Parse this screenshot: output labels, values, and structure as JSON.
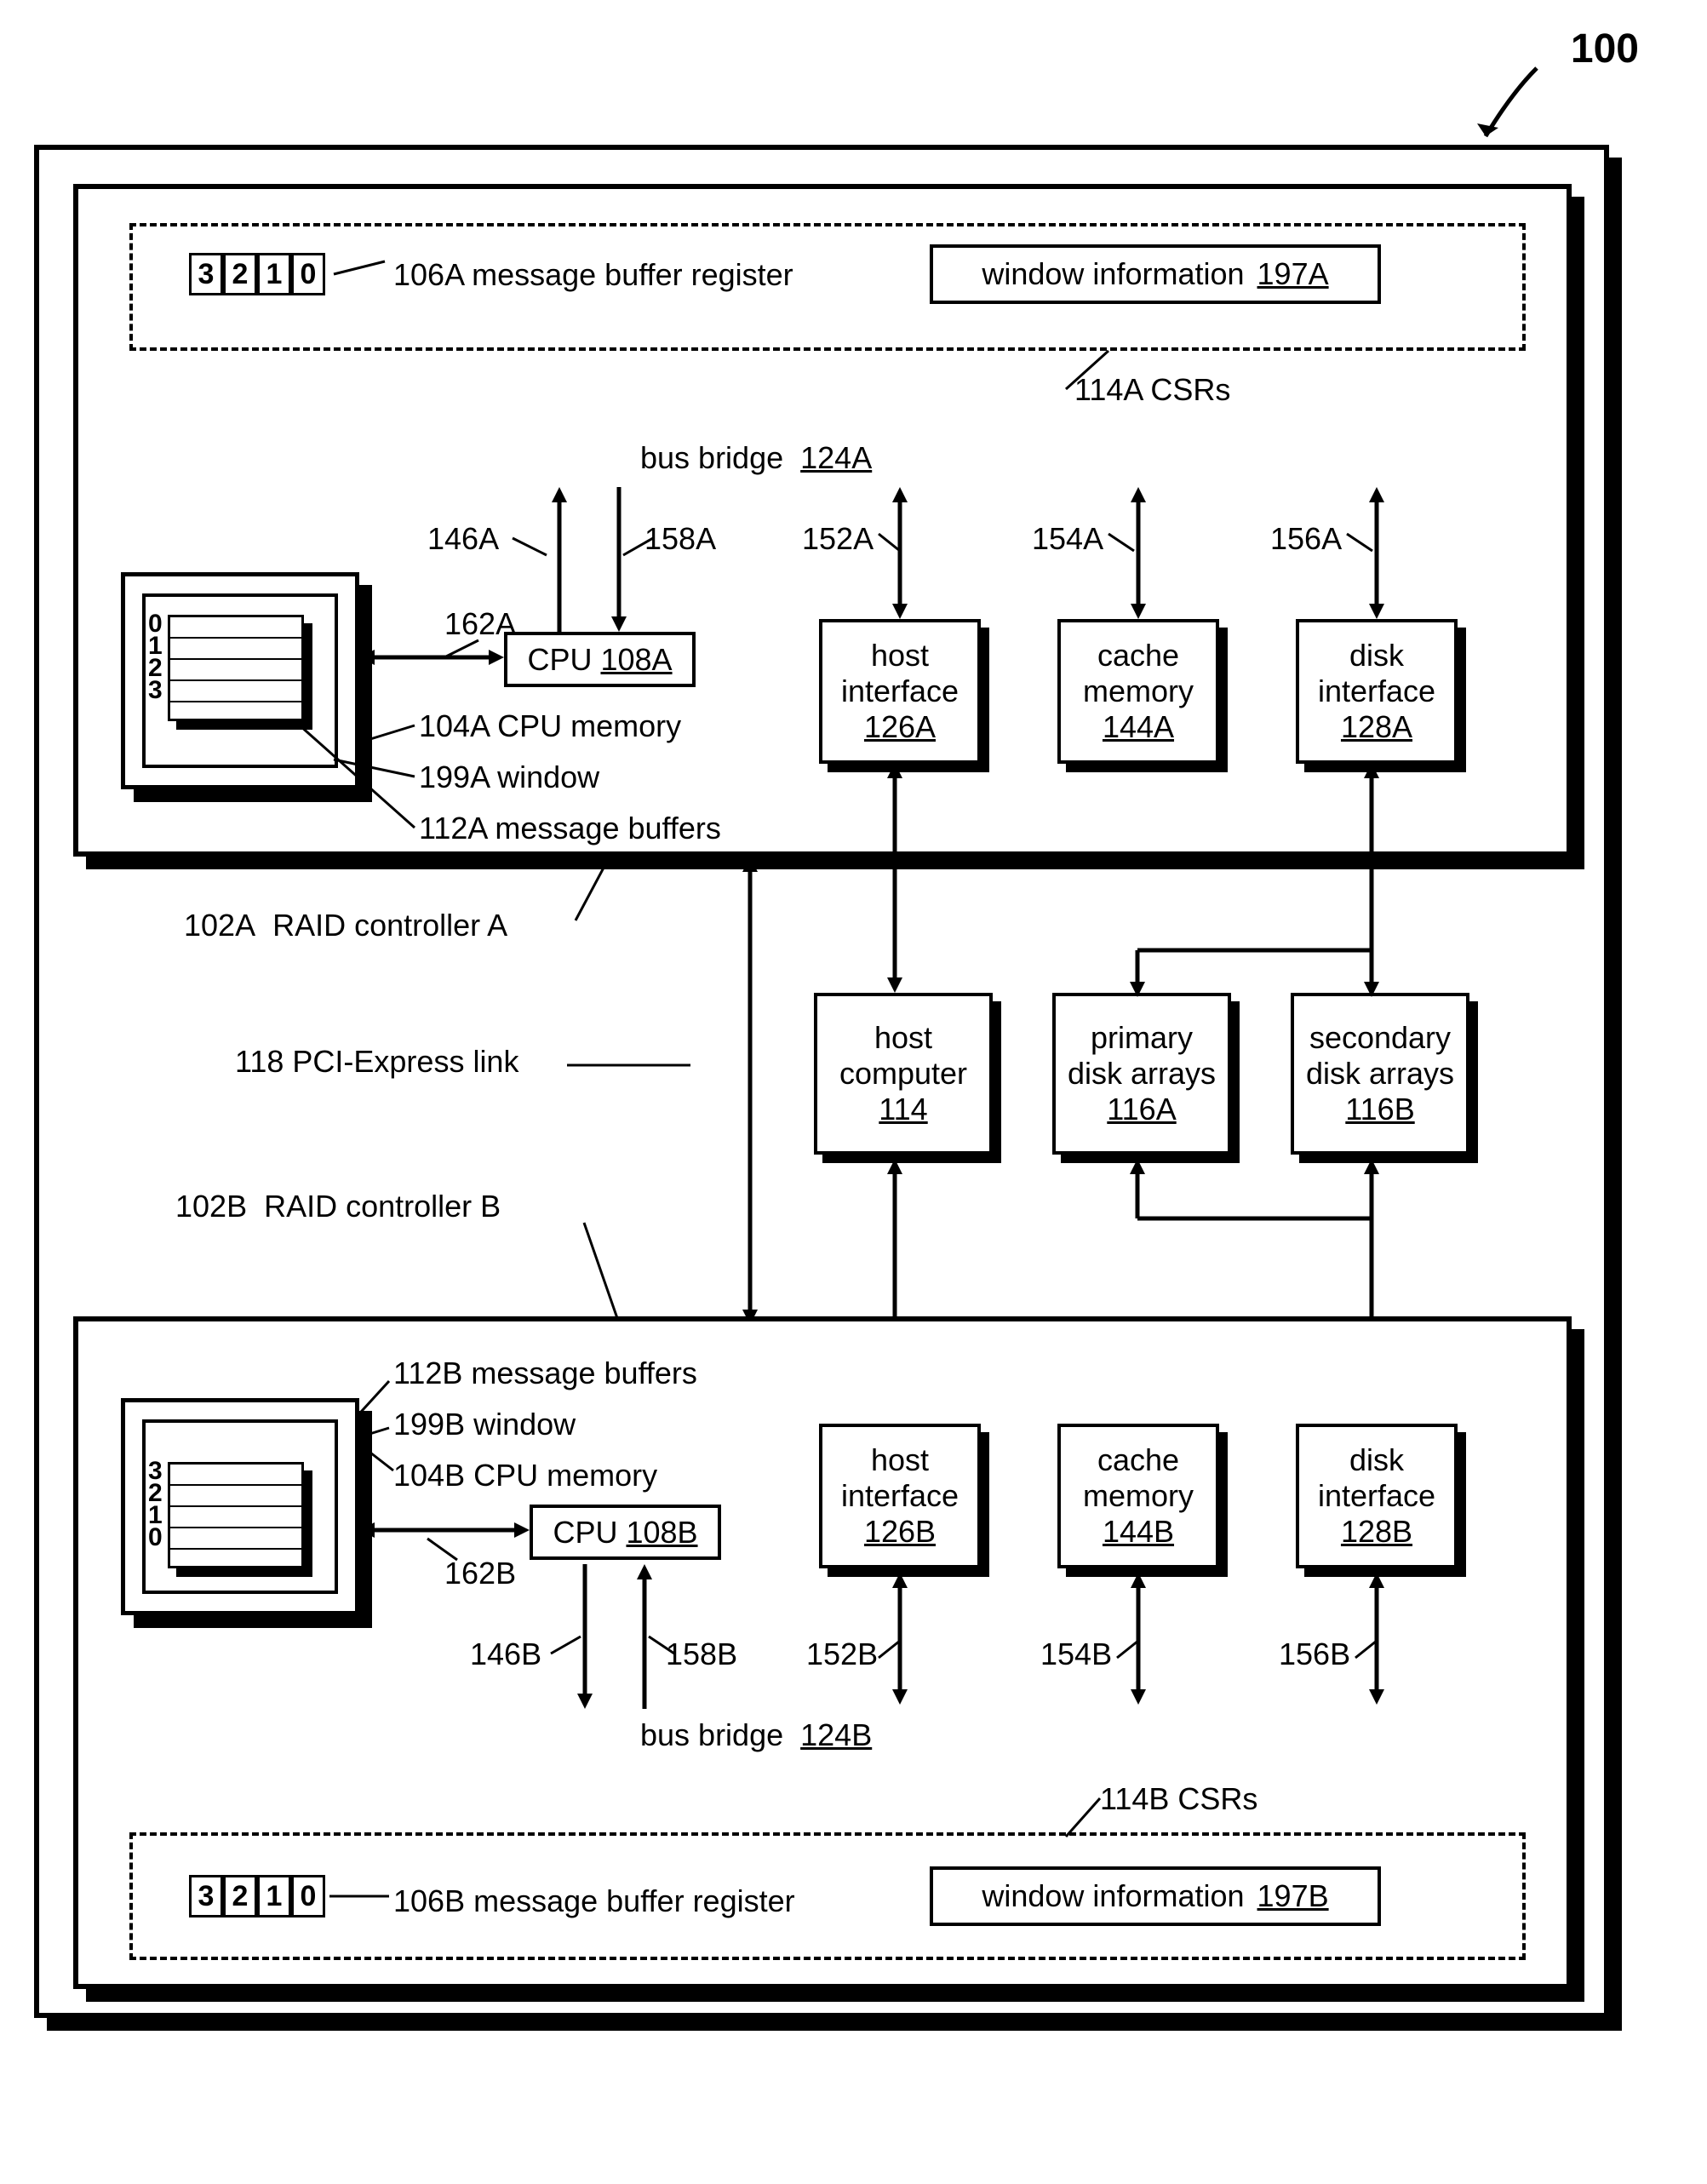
{
  "figure_ref": "100",
  "controllers": {
    "A": {
      "id": "102A",
      "name": "RAID controller A",
      "bus_bridge": {
        "label": "bus bridge",
        "ref": "124A"
      },
      "csrs_label": "114A CSRs",
      "msg_buf_reg": {
        "cells": [
          "3",
          "2",
          "1",
          "0"
        ],
        "label": "106A  message buffer register"
      },
      "window_info": {
        "label": "window information",
        "ref": "197A"
      },
      "cpu": {
        "label": "CPU",
        "ref": "108A"
      },
      "cpu_memory": "104A  CPU memory",
      "window": "199A  window",
      "msg_buffers": "112A message buffers",
      "mem_nums": [
        "0",
        "1",
        "2",
        "3"
      ],
      "arrows": {
        "a146": "146A",
        "a158": "158A",
        "a162": "162A",
        "a152": "152A",
        "a154": "154A",
        "a156": "156A"
      },
      "host_if": {
        "l1": "host",
        "l2": "interface",
        "ref": "126A"
      },
      "cache": {
        "l1": "cache",
        "l2": "memory",
        "ref": "144A"
      },
      "disk_if": {
        "l1": "disk",
        "l2": "interface",
        "ref": "128A"
      }
    },
    "B": {
      "id": "102B",
      "name": "RAID controller B",
      "bus_bridge": {
        "label": "bus bridge",
        "ref": "124B"
      },
      "csrs_label": "114B CSRs",
      "msg_buf_reg": {
        "cells": [
          "3",
          "2",
          "1",
          "0"
        ],
        "label": "106B  message buffer register"
      },
      "window_info": {
        "label": "window information",
        "ref": "197B"
      },
      "cpu": {
        "label": "CPU",
        "ref": "108B"
      },
      "cpu_memory": "104B  CPU memory",
      "window": "199B  window",
      "msg_buffers": "112B message buffers",
      "mem_nums": [
        "3",
        "2",
        "1",
        "0"
      ],
      "arrows": {
        "a146": "146B",
        "a158": "158B",
        "a162": "162B",
        "a152": "152B",
        "a154": "154B",
        "a156": "156B"
      },
      "host_if": {
        "l1": "host",
        "l2": "interface",
        "ref": "126B"
      },
      "cache": {
        "l1": "cache",
        "l2": "memory",
        "ref": "144B"
      },
      "disk_if": {
        "l1": "disk",
        "l2": "interface",
        "ref": "128B"
      }
    }
  },
  "middle": {
    "pci_link": "118  PCI-Express link",
    "host": {
      "l1": "host",
      "l2": "computer",
      "ref": "114"
    },
    "primary": {
      "l1": "primary",
      "l2": "disk arrays",
      "ref": "116A"
    },
    "secondary": {
      "l1": "secondary",
      "l2": "disk arrays",
      "ref": "116B"
    }
  }
}
